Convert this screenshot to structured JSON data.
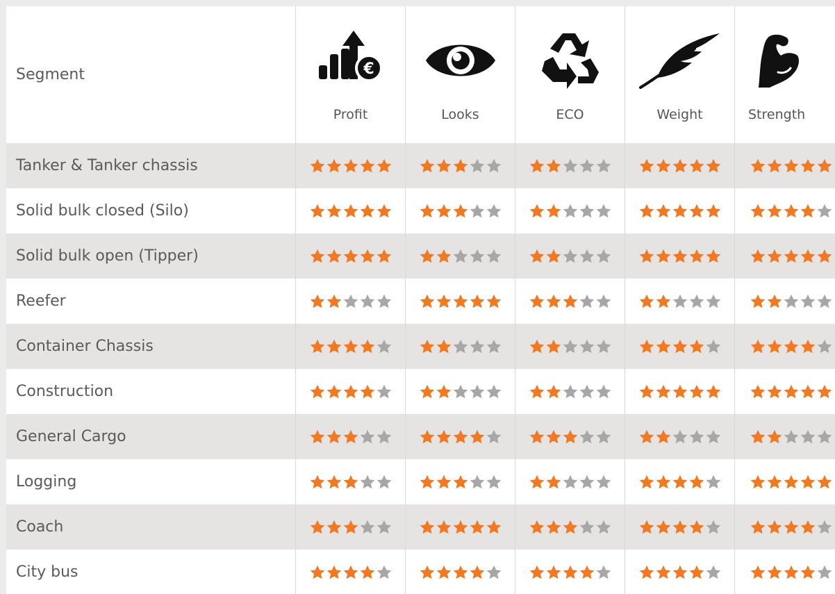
{
  "header": {
    "segment_label": "Segment",
    "columns": [
      {
        "label": "Profit",
        "icon": "profit-chart-euro-icon"
      },
      {
        "label": "Looks",
        "icon": "eye-icon"
      },
      {
        "label": "ECO",
        "icon": "recycle-icon"
      },
      {
        "label": "Weight",
        "icon": "feather-icon"
      },
      {
        "label": "Strength",
        "icon": "flexed-arm-icon"
      }
    ]
  },
  "colors": {
    "star_on": "#f07a23",
    "star_off": "#a8a6a6",
    "row_shade": "#e6e3e3"
  },
  "max_rating": 5,
  "rows": [
    {
      "segment": "Tanker & Tanker chassis",
      "ratings": [
        5,
        3,
        2,
        5,
        5
      ]
    },
    {
      "segment": "Solid bulk closed (Silo)",
      "ratings": [
        5,
        3,
        2,
        5,
        4
      ]
    },
    {
      "segment": "Solid bulk open (Tipper)",
      "ratings": [
        5,
        2,
        2,
        5,
        5
      ]
    },
    {
      "segment": "Reefer",
      "ratings": [
        2,
        5,
        3,
        2,
        2
      ]
    },
    {
      "segment": "Container Chassis",
      "ratings": [
        4,
        2,
        2,
        4,
        4
      ]
    },
    {
      "segment": "Construction",
      "ratings": [
        4,
        2,
        2,
        5,
        5
      ]
    },
    {
      "segment": "General Cargo",
      "ratings": [
        3,
        4,
        3,
        2,
        2
      ]
    },
    {
      "segment": "Logging",
      "ratings": [
        3,
        3,
        2,
        4,
        5
      ]
    },
    {
      "segment": "Coach",
      "ratings": [
        3,
        5,
        3,
        4,
        4
      ]
    },
    {
      "segment": "City bus",
      "ratings": [
        4,
        4,
        4,
        4,
        4
      ]
    }
  ]
}
